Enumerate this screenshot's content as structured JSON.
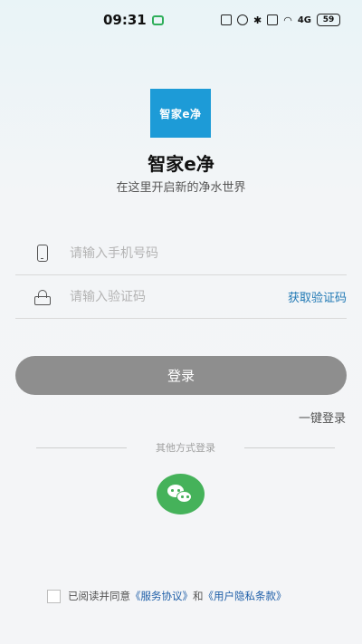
{
  "status_bar": {
    "time": "09:31",
    "signal_text": "4G",
    "battery": "59"
  },
  "app": {
    "logo_text": "智家e净",
    "name": "智家e净",
    "slogan": "在这里开启新的净水世界"
  },
  "form": {
    "phone_placeholder": "请输入手机号码",
    "code_placeholder": "请输入验证码",
    "get_code_label": "获取验证码",
    "login_label": "登录",
    "one_key_label": "一键登录"
  },
  "other_login": {
    "divider_text": "其他方式登录",
    "wechat_icon": "wechat-icon"
  },
  "agreement": {
    "prefix": "已阅读并同意",
    "service_link": "《服务协议》",
    "and": "和",
    "privacy_link": "《用户隐私条款》"
  },
  "colors": {
    "accent_link": "#1f78b4",
    "login_button": "#8e8e8e",
    "wechat_green": "#45b25a",
    "logo_blue": "#1d9bd7"
  }
}
